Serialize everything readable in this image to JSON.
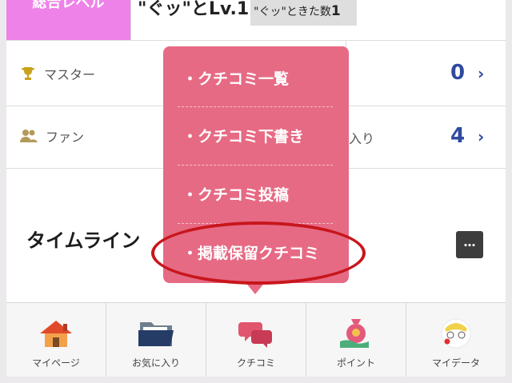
{
  "header": {
    "level_tab": "総合レベル",
    "level_value": "\"ぐッ\"とLv.1",
    "count_label": "\"ぐッ\"ときた数",
    "count_value": "1"
  },
  "rows": [
    {
      "label": "マスター",
      "icon": "trophy-icon",
      "count": "0"
    },
    {
      "label": "ファン",
      "icon": "people-icon",
      "count": "4",
      "partial_text": "入り"
    }
  ],
  "timeline": {
    "title": "タイムライン",
    "more_label": "…"
  },
  "popup": {
    "items": [
      "・クチコミ一覧",
      "・クチコミ下書き",
      "・クチコミ投稿",
      "・掲載保留クチコミ"
    ]
  },
  "bottom_nav": [
    {
      "label": "マイページ",
      "icon": "home-icon"
    },
    {
      "label": "お気に入り",
      "icon": "folder-icon"
    },
    {
      "label": "クチコミ",
      "icon": "chat-bubbles-icon"
    },
    {
      "label": "ポイント",
      "icon": "money-bag-icon"
    },
    {
      "label": "マイデータ",
      "icon": "avatar-icon"
    }
  ],
  "colors": {
    "accent_pink": "#e66a84",
    "level_tab": "#ee82e8",
    "count_blue": "#2f4aa0",
    "highlight_red": "#c8161c"
  }
}
